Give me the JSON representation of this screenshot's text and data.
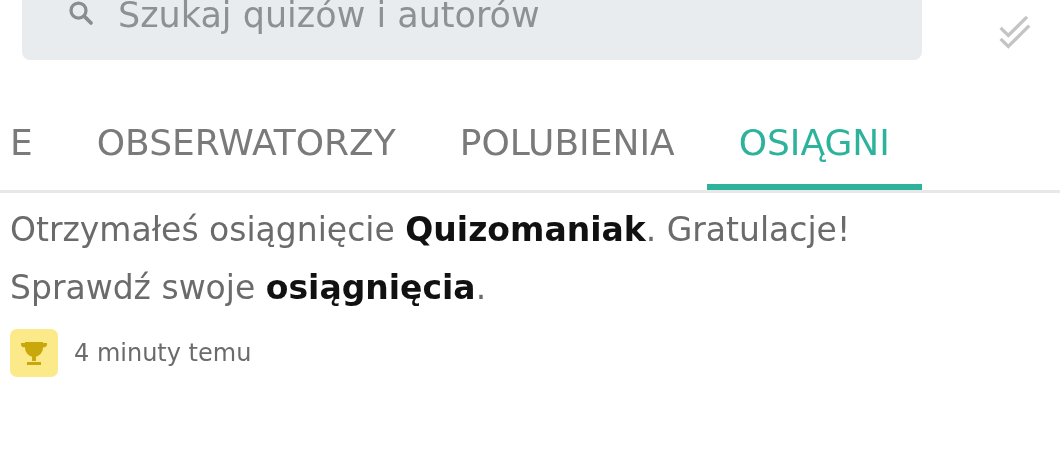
{
  "search": {
    "placeholder": "Szukaj quizów i autorów"
  },
  "tabs": [
    {
      "label": "E",
      "selected": false
    },
    {
      "label": "OBSERWATORZY",
      "selected": false
    },
    {
      "label": "POLUBIENIA",
      "selected": false
    },
    {
      "label": "OSIĄGNI",
      "selected": true
    }
  ],
  "notifications": [
    {
      "kind": "achievement",
      "message": "Otrzymałeś osiągnięcie **Quizomaniak**. Gratulacje! Sprawdź swoje **osiągnięcia**.",
      "time": "4 minuty temu"
    }
  ]
}
